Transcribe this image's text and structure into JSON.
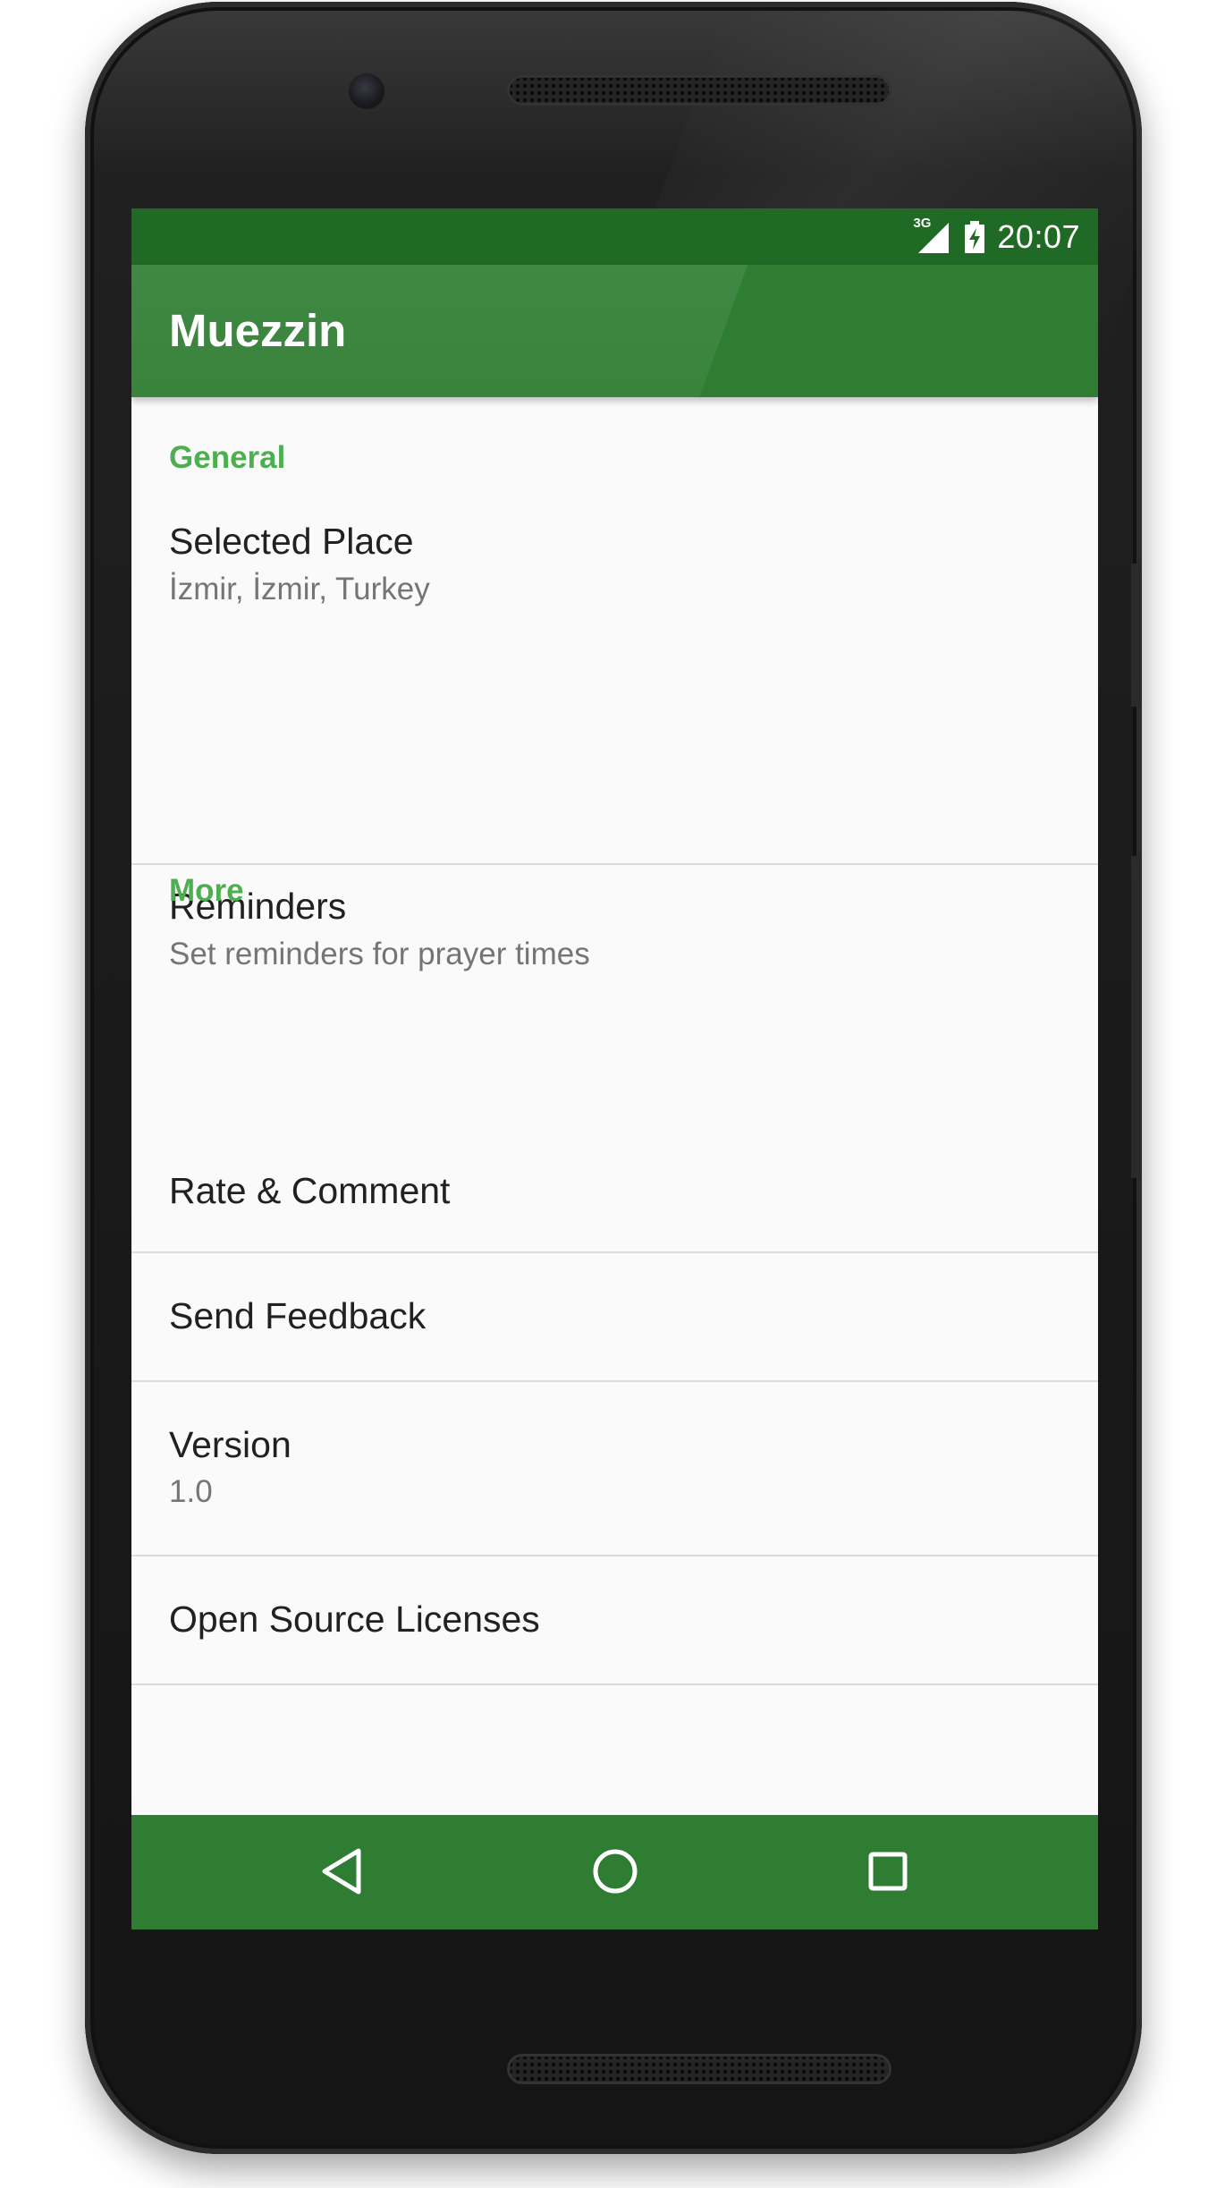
{
  "status_bar": {
    "network": "3G",
    "time": "20:07"
  },
  "app_bar": {
    "title": "Muezzin"
  },
  "settings": {
    "general_header": "General",
    "selected_place_title": "Selected Place",
    "selected_place_summary": "İzmir, İzmir, Turkey",
    "reminders_title": "Reminders",
    "reminders_summary": "Set reminders for prayer times",
    "more_header": "More",
    "rate_title": "Rate & Comment",
    "feedback_title": "Send Feedback",
    "version_title": "Version",
    "version_summary": "1.0",
    "licenses_title": "Open Source Licenses"
  },
  "navigation": {
    "back_icon": "back-triangle-icon",
    "home_icon": "home-circle-icon",
    "recents_icon": "recents-square-icon"
  },
  "colors": {
    "primary": "#2e7d32",
    "primary_dark": "#1f6a24",
    "accent": "#4caf50",
    "background": "#fafafa"
  }
}
